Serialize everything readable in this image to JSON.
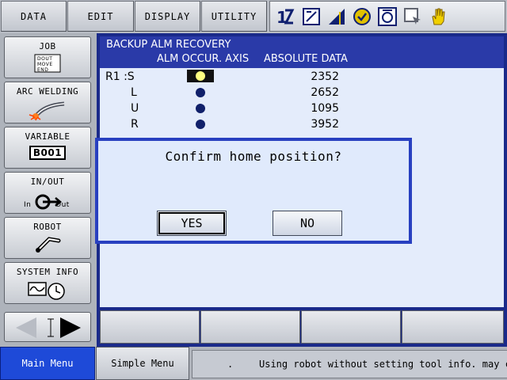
{
  "menubar": {
    "buttons": [
      "DATA",
      "EDIT",
      "DISPLAY",
      "UTILITY"
    ]
  },
  "leftmenu": {
    "items": [
      {
        "label": "JOB",
        "icon": "job-icon",
        "icon_lines": [
          "DOUT",
          "MOVE",
          "END"
        ]
      },
      {
        "label": "ARC WELDING",
        "icon": "arc-welding-icon"
      },
      {
        "label": "VARIABLE",
        "icon": "variable-icon",
        "badge": "B001"
      },
      {
        "label": "IN/OUT",
        "icon": "in-out-icon",
        "in_label": "In",
        "out_label": "Out"
      },
      {
        "label": "ROBOT",
        "icon": "robot-arm-icon"
      },
      {
        "label": "SYSTEM INFO",
        "icon": "system-info-icon"
      }
    ]
  },
  "screen": {
    "title": "BACKUP ALM RECOVERY",
    "col_alm": "ALM OCCUR. AXIS",
    "col_abs": "ABSOLUTE DATA",
    "rows": [
      {
        "axis": "R1 :S",
        "value": "2352",
        "selected": true
      },
      {
        "axis": "L",
        "value": "2652",
        "selected": false
      },
      {
        "axis": "U",
        "value": "1095",
        "selected": false
      },
      {
        "axis": "R",
        "value": "3952",
        "selected": false
      }
    ]
  },
  "dialog": {
    "message": "Confirm home position?",
    "yes_label": "YES",
    "no_label": "NO"
  },
  "bottombar": {
    "main_menu": "Main Menu",
    "simple_menu": "Simple Menu",
    "status_dot": ".",
    "status_message": "Using robot without setting tool info. may ca"
  },
  "colors": {
    "accent": "#2a3aa8",
    "main_menu_bg": "#1e4ad8",
    "dialog_border": "#2840c0",
    "content_bg": "#e4ecfb"
  }
}
